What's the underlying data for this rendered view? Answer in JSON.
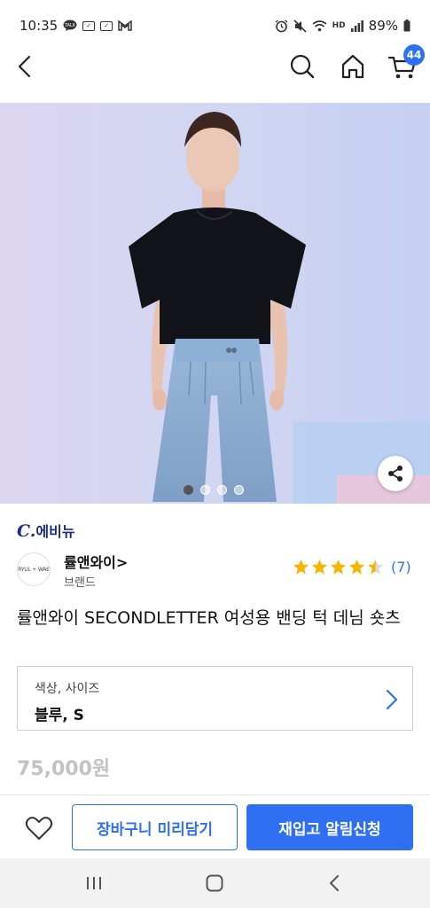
{
  "status_bar": {
    "time": "10:35",
    "battery": "89%",
    "hd_label": "HD"
  },
  "nav": {
    "cart_count": "44"
  },
  "mall": {
    "logo_c": "C.",
    "logo_text": "에비뉴"
  },
  "brand": {
    "logo_text": "RYUL + WAE",
    "name": "률앤와이>",
    "type": "브랜드"
  },
  "rating": {
    "stars": 4.5,
    "count": "(7)"
  },
  "product": {
    "title": "률앤와이 SECONDLETTER 여성용 밴딩 턱 데님 숏츠",
    "price": "75,000원"
  },
  "option": {
    "label": "색상, 사이즈",
    "value": "블루, S"
  },
  "carousel": {
    "total": 4,
    "active": 1
  },
  "actions": {
    "cart_label": "장바구니 미리담기",
    "restock_label": "재입고 알림신청"
  },
  "colors": {
    "accent": "#2f6ff2",
    "star": "#f7b500",
    "price_muted": "#c2c2c2"
  }
}
